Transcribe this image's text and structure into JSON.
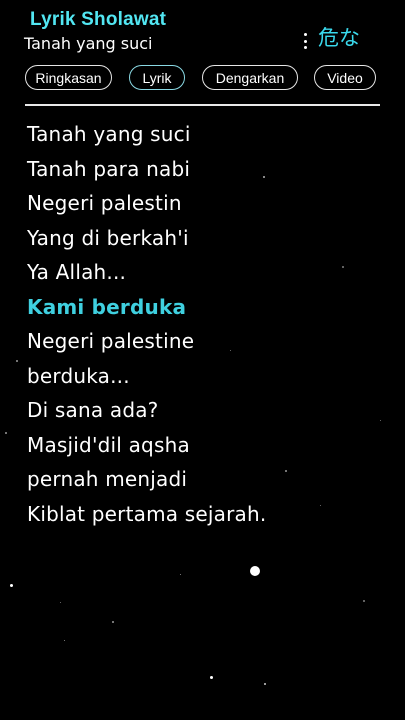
{
  "header": {
    "channel_title": "Lyrik Sholawat",
    "song_title": "Tanah yang suci",
    "warning_mark": "危な",
    "menu_icon": "more-vertical-icon"
  },
  "tabs": [
    {
      "label": "Ringkasan",
      "active": false
    },
    {
      "label": "Lyrik",
      "active": true
    },
    {
      "label": "Dengarkan",
      "active": false
    },
    {
      "label": "Video",
      "active": false
    }
  ],
  "lyrics": {
    "lines": [
      "Tanah yang suci",
      "Tanah para nabi",
      "Negeri palestin",
      "Yang di berkah'i",
      "Ya Allah...",
      "Kami berduka",
      "Negeri palestine",
      "berduka...",
      "Di sana ada?",
      "Masjid'dil aqsha",
      "pernah menjadi",
      "Kiblat pertama sejarah."
    ],
    "current_index": 5
  },
  "colors": {
    "background": "#000000",
    "accent": "#52e6f2",
    "highlight": "#3fd0e0",
    "text": "#ffffff"
  }
}
